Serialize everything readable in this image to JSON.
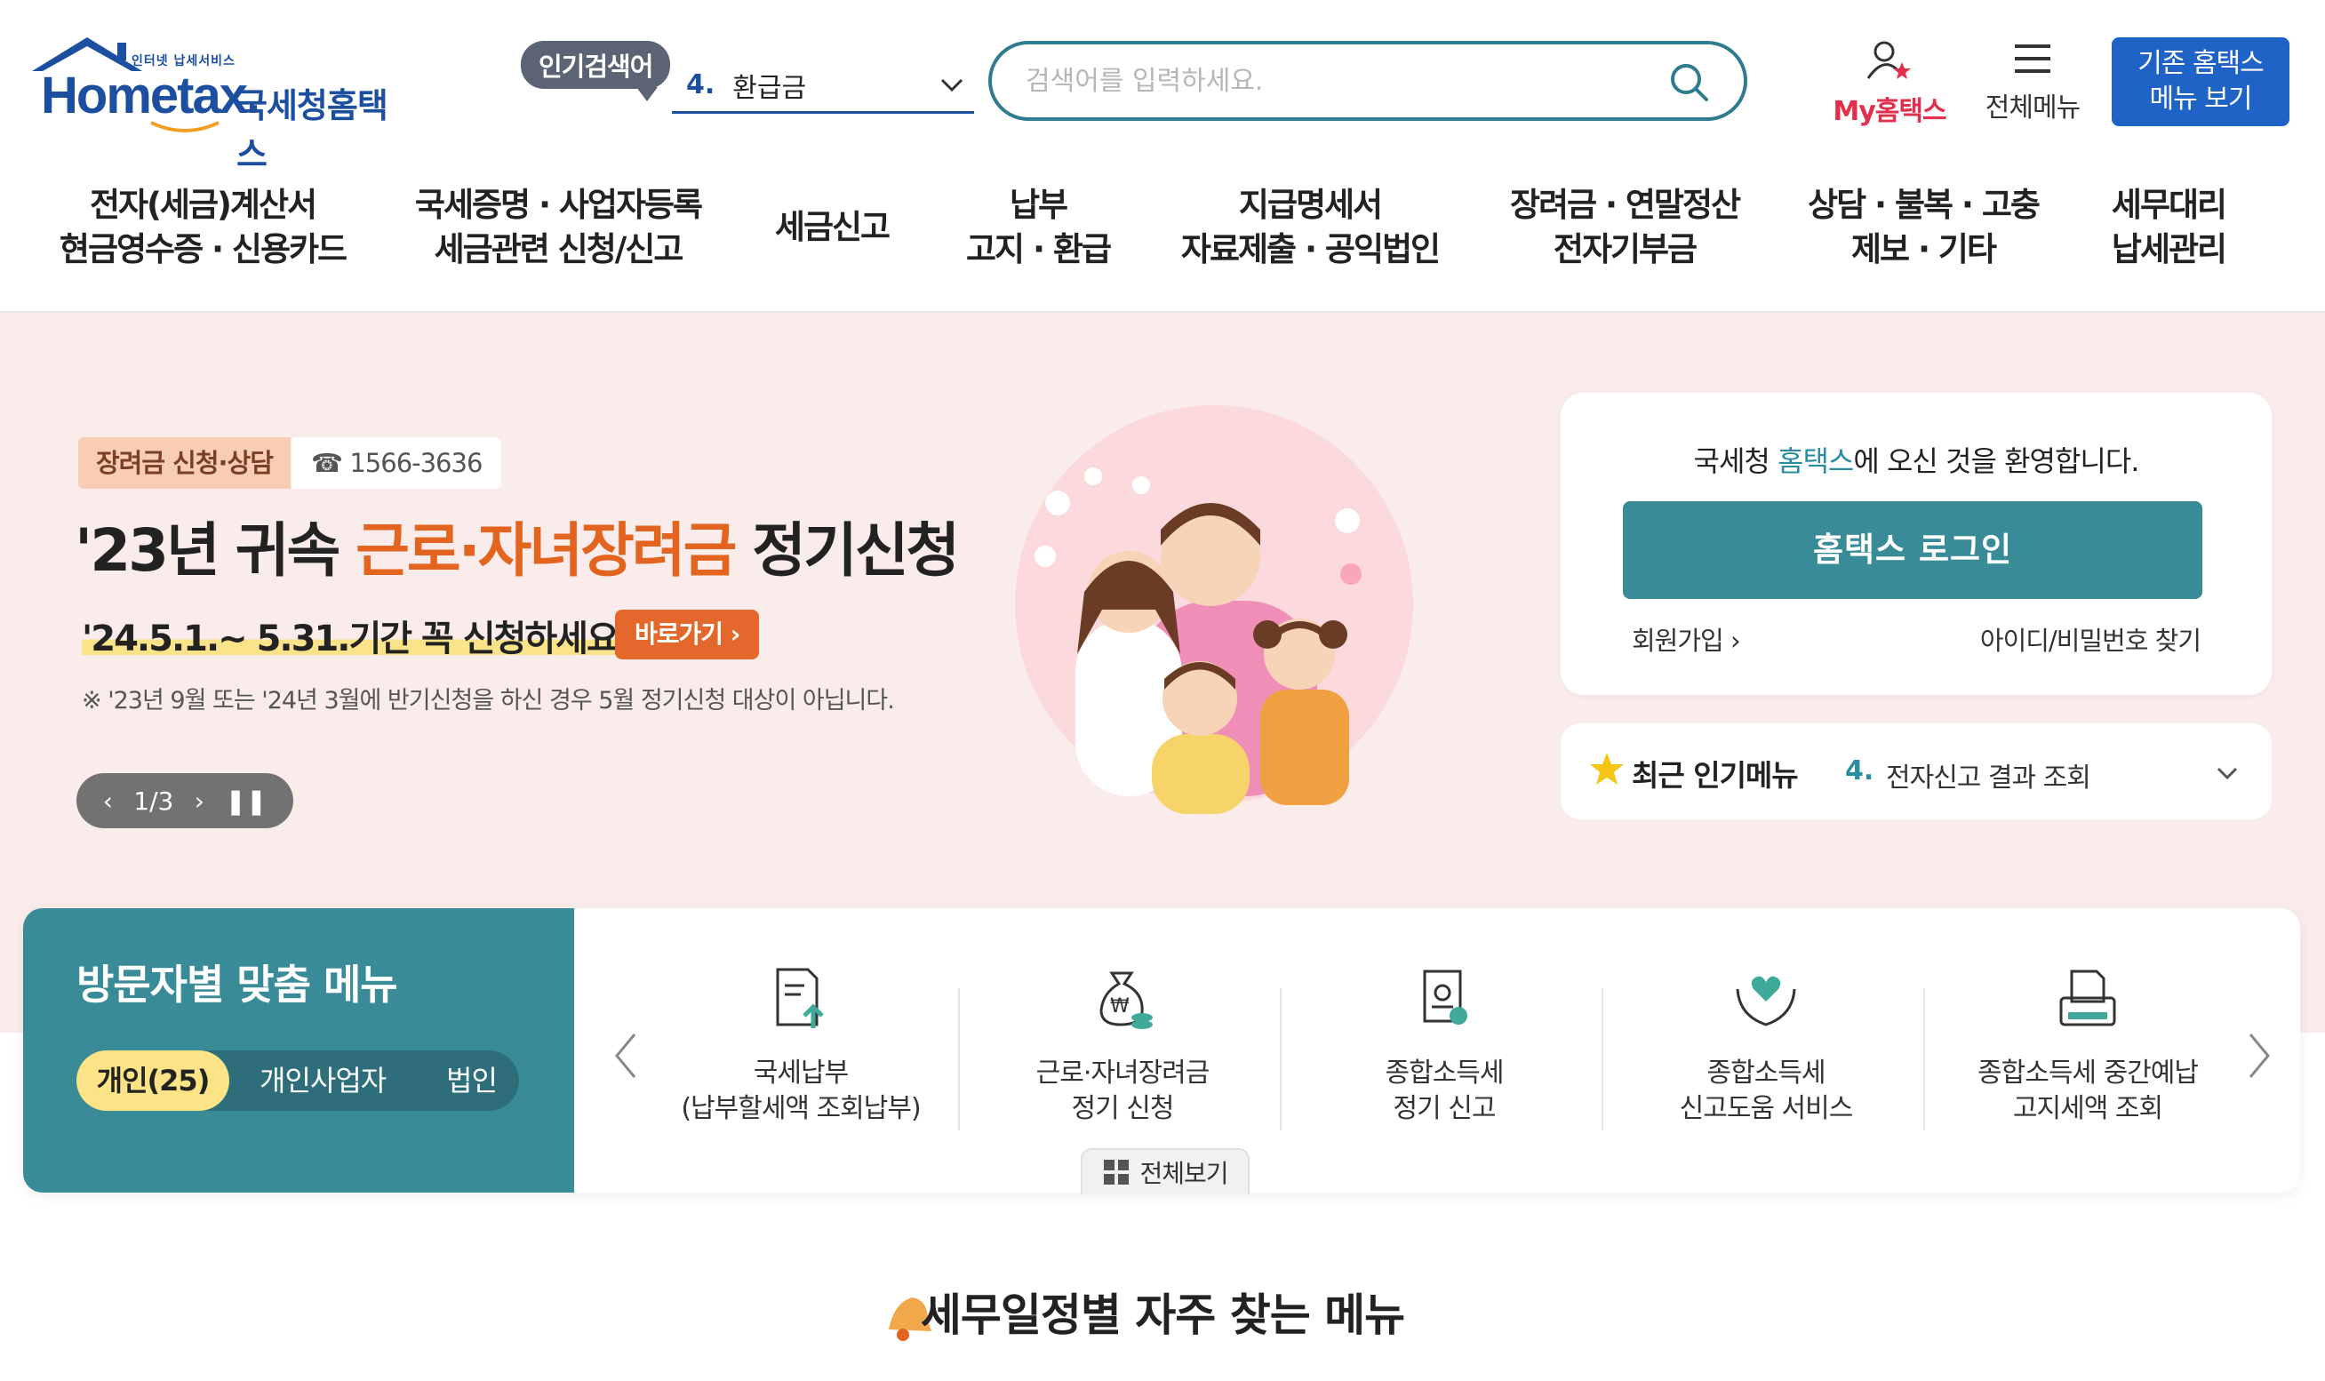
{
  "logo": {
    "tagline": "인터넷 납세서비스",
    "wordmark": "Hometax.",
    "korean": "국세청홈택스",
    "color": "#1c4fa0"
  },
  "header": {
    "popular_label": "인기검색어",
    "popular_rank": "4.",
    "popular_term": "환급금",
    "search_placeholder": "검색어를 입력하세요.",
    "my_label": "My홈택스",
    "allmenu_label": "전체메뉴",
    "legacy_line1": "기존 홈택스",
    "legacy_line2": "메뉴 보기"
  },
  "gnb": [
    {
      "line1": "전자(세금)계산서",
      "line2": "현금영수증 · 신용카드"
    },
    {
      "line1": "국세증명 · 사업자등록",
      "line2": "세금관련 신청/신고"
    },
    {
      "line1": "세금신고",
      "line2": ""
    },
    {
      "line1": "납부",
      "line2": "고지 · 환급"
    },
    {
      "line1": "지급명세서",
      "line2": "자료제출 · 공익법인"
    },
    {
      "line1": "장려금 · 연말정산",
      "line2": "전자기부금"
    },
    {
      "line1": "상담 · 불복 · 고충",
      "line2": "제보 · 기타"
    },
    {
      "line1": "세무대리",
      "line2": "납세관리"
    }
  ],
  "hero": {
    "badge": "장려금 신청·상담",
    "phone": "☎ 1566-3636",
    "title_pre": "'23년 귀속 ",
    "title_hl": "근로·자녀장려금",
    "title_post": " 정기신청",
    "subtitle": "'24.5.1.~ 5.31.기간 꼭 신청하세요!",
    "goto": "바로가기",
    "note": "※ '23년 9월 또는 '24년 3월에 반기신청을 하신 경우 5월 정기신청 대상이 아닙니다.",
    "pager": "1/3",
    "bg_color": "#f9ecea",
    "accent": "#e2641f"
  },
  "login": {
    "welcome_pre": "국세청 ",
    "welcome_hl": "홈택스",
    "welcome_post": "에 오신 것을 환영합니다.",
    "button": "홈택스 로그인",
    "join": "회원가입",
    "find": "아이디/비밀번호 찾기",
    "button_color": "#3a8b98"
  },
  "recent": {
    "title": "최근 인기메뉴",
    "rank": "4.",
    "item": "전자신고 결과 조회"
  },
  "visitor": {
    "title": "방문자별 맞춤 메뉴",
    "tabs": [
      "개인(25)",
      "개인사업자",
      "법인"
    ],
    "services": [
      {
        "icon": "document-upload-icon",
        "line1": "국세납부",
        "line2": "(납부할세액 조회납부)"
      },
      {
        "icon": "money-bag-icon",
        "line1": "근로·자녀장려금",
        "line2": "정기 신청"
      },
      {
        "icon": "tax-certificate-icon",
        "line1": "종합소득세",
        "line2": "정기 신고"
      },
      {
        "icon": "heart-hands-icon",
        "line1": "종합소득세",
        "line2": "신고도움 서비스"
      },
      {
        "icon": "printer-doc-icon",
        "line1": "종합소득세 중간예납",
        "line2": "고지세액 조회"
      }
    ],
    "viewall": "전체보기"
  },
  "bottom": {
    "title": "세무일정별 자주 찾는 메뉴"
  }
}
